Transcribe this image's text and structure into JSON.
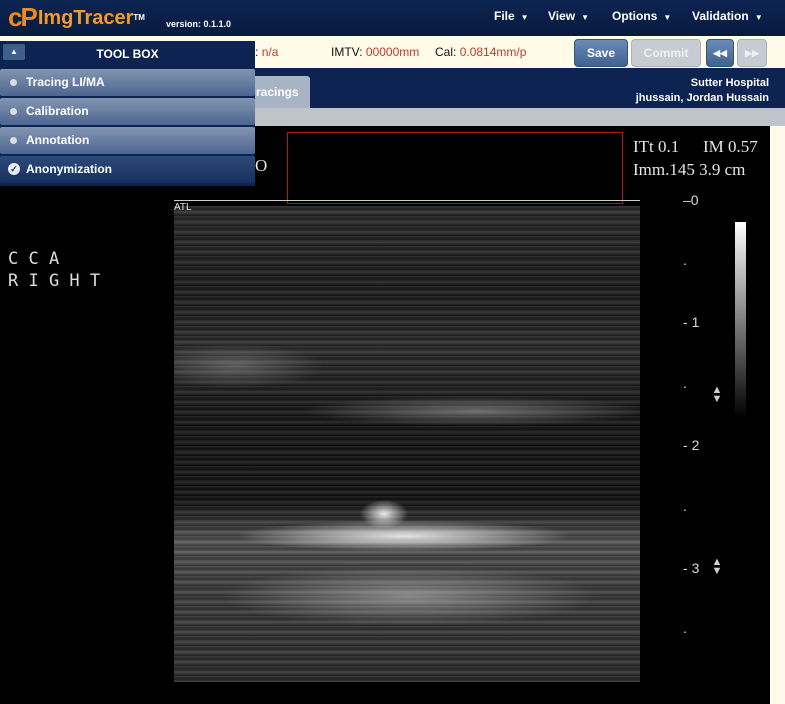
{
  "app": {
    "logo_mark": "cP",
    "logo_text": "ImgTracer",
    "logo_tm": "TM",
    "version": "version: 0.1.1.0"
  },
  "menu": [
    {
      "label": "File"
    },
    {
      "label": "View"
    },
    {
      "label": "Options"
    },
    {
      "label": "Validation"
    }
  ],
  "status": {
    "field1_label": ":",
    "field1_value": "n/a",
    "imtv_label": "IMTV:",
    "imtv_value": "00000mm",
    "cal_label": "Cal:",
    "cal_value": "0.0814mm/p"
  },
  "buttons": {
    "save": "Save",
    "commit": "Commit",
    "prev": "◀◀",
    "next": "▶▶"
  },
  "tab": {
    "label": "racings"
  },
  "hospital": {
    "name": "Sutter Hospital",
    "user": "jhussain, Jordan Hussain"
  },
  "toolbox": {
    "title": "TOOL BOX",
    "items": [
      {
        "label": "Tracing LI/MA",
        "active": false
      },
      {
        "label": "Calibration",
        "active": false
      },
      {
        "label": "Annotation",
        "active": false
      },
      {
        "label": "Anonymization",
        "active": true
      }
    ]
  },
  "image": {
    "partial_label": "O",
    "itt": "ITt 0.1",
    "im": "IM 0.57",
    "imm": "Imm.145 3.9 cm",
    "site_line1": "C C A",
    "site_line2": "R I G H T",
    "atl": "ATL",
    "depth": [
      "0",
      "1",
      "2",
      "3"
    ],
    "tick": "."
  },
  "colors": {
    "nav_bg": "#0d2452",
    "status_bg": "#fffbe8",
    "value_red": "#c0392b",
    "accent_orange": "#f39a28",
    "anonymize_box": "#b01818"
  }
}
